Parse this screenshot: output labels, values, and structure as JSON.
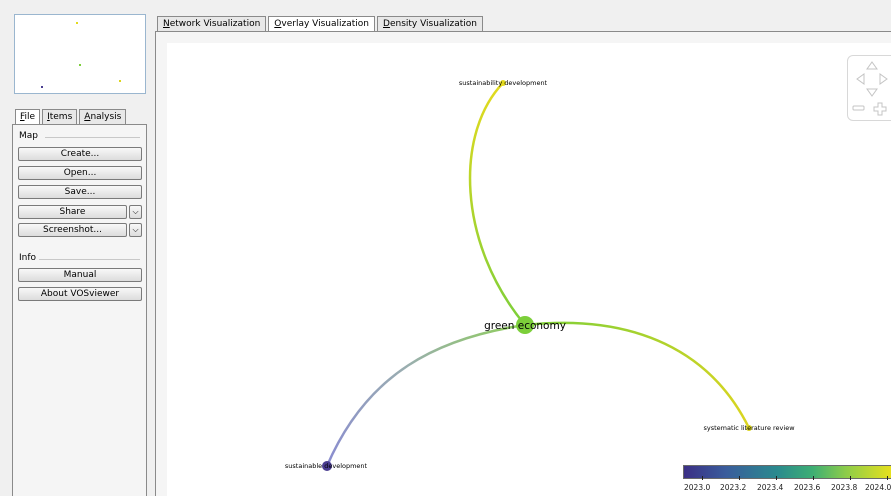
{
  "side_tabs": [
    {
      "key": "F",
      "rest": "ile",
      "active": true
    },
    {
      "key": "I",
      "rest": "tems",
      "active": false
    },
    {
      "key": "A",
      "rest": "nalysis",
      "active": false
    }
  ],
  "map_group": {
    "title": "Map",
    "buttons": {
      "create": "Create...",
      "open": "Open...",
      "save": "Save...",
      "share": "Share",
      "screenshot": "Screenshot..."
    },
    "dropdown_arrow": "⌵"
  },
  "info_group": {
    "title": "Info",
    "buttons": {
      "manual": "Manual",
      "about": "About VOSviewer"
    }
  },
  "main_tabs": [
    {
      "key": "N",
      "rest": "etwork Visualization",
      "active": false
    },
    {
      "key": "O",
      "rest": "verlay Visualization",
      "active": true
    },
    {
      "key": "D",
      "rest": "ensity Visualization",
      "active": false
    }
  ],
  "nodes": {
    "green_economy": {
      "label": "green economy",
      "color": "#7ccf3a"
    },
    "sustainability_development": {
      "label": "sustainability development",
      "color": "#e3da1e"
    },
    "systematic_literature_review": {
      "label": "systematic literature review",
      "color": "#dcd51f"
    },
    "sustainable_development": {
      "label": "sustainable development",
      "color": "#4a3d90"
    }
  },
  "legend": {
    "ticks": [
      "2023.0",
      "2023.2",
      "2023.4",
      "2023.6",
      "2023.8",
      "2024.0"
    ],
    "colors": [
      "#3b2f85",
      "#2a8a8e",
      "#8ccc4a",
      "#e6e01e"
    ]
  }
}
